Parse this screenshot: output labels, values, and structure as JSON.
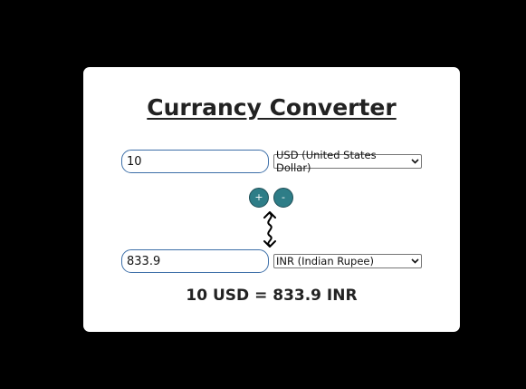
{
  "converter": {
    "title": "Currancy Converter",
    "from_amount": "10",
    "from_currency": "USD (United States Dollar)",
    "to_amount": "833.9",
    "to_currency": "INR (Indian Rupee)",
    "plus_label": "+",
    "minus_label": "-",
    "result": "10 USD = 833.9 INR"
  },
  "icons": {
    "swap": "swap-vertical-arrows-icon",
    "dropdown": "chevron-down-icon"
  },
  "colors": {
    "page_background": "#000000",
    "card_background": "#ffffff",
    "button_fill": "#2e7d87",
    "input_border": "#3d6fa8"
  }
}
